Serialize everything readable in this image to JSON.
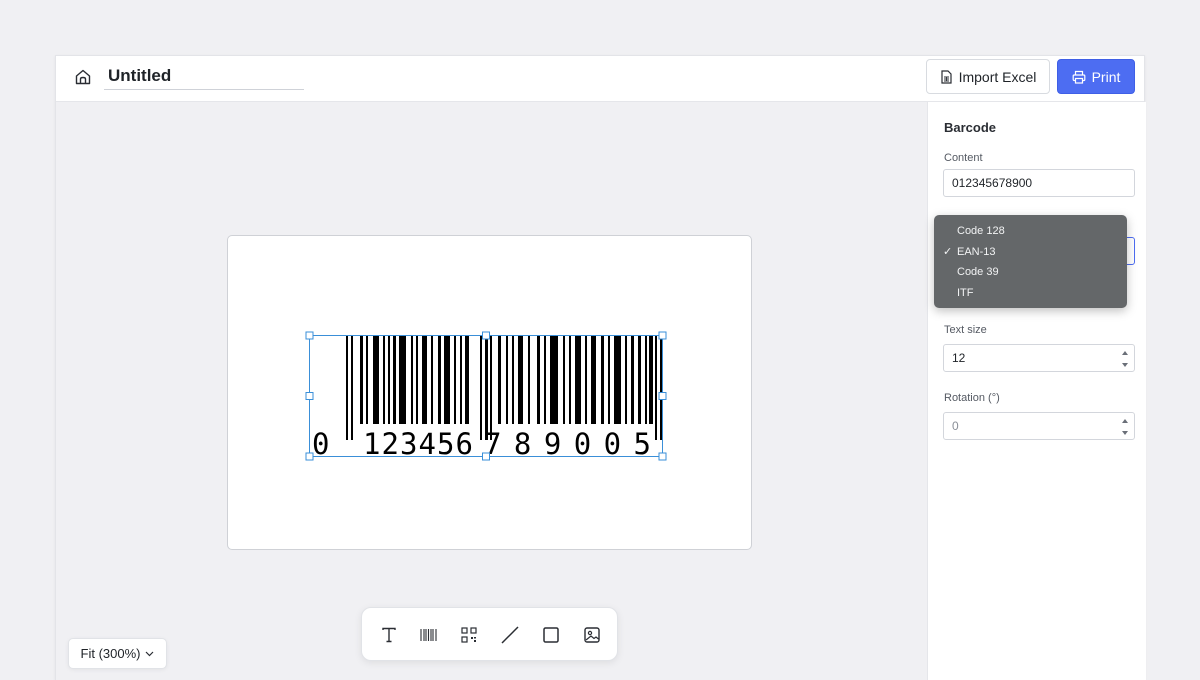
{
  "header": {
    "title": "Untitled",
    "import_label": "Import Excel",
    "print_label": "Print",
    "accent": "#4d6df2"
  },
  "panel": {
    "title": "Barcode",
    "content_label": "Content",
    "content_value": "012345678900",
    "type_options": [
      "Code 128",
      "EAN-13",
      "Code 39",
      "ITF"
    ],
    "type_selected": "EAN-13",
    "text_size_label": "Text size",
    "text_size_value": "12",
    "rotation_label": "Rotation (°)",
    "rotation_value": "0"
  },
  "canvas": {
    "barcode_text_left": "0",
    "barcode_text_mid1": "123456",
    "barcode_text_mid2": "789005"
  },
  "toolbar": {
    "tools": [
      "text-tool",
      "barcode-tool",
      "qrcode-tool",
      "line-tool",
      "rectangle-tool",
      "image-tool"
    ]
  },
  "zoom": {
    "label": "Fit (300%)"
  }
}
